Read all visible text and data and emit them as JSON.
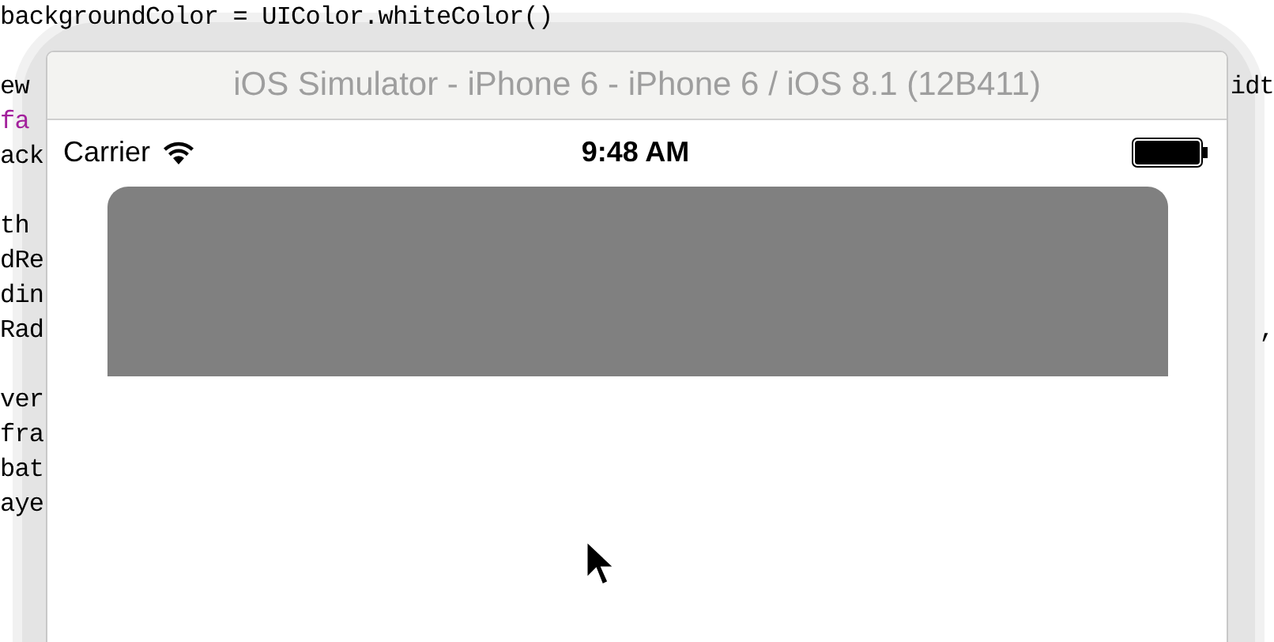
{
  "editor": {
    "blocks": [
      [
        {
          "kind": "plain",
          "text": "backgroundColor = UIColor.whiteColor()"
        }
      ],
      [
        {
          "kind": "plain",
          "text": "ew",
          "right": "idt"
        },
        {
          "kind": "keyword",
          "text": "fa"
        },
        {
          "kind": "plain",
          "text": "ack"
        }
      ],
      [
        {
          "kind": "plain",
          "text": "th"
        },
        {
          "kind": "plain",
          "text": "dRe"
        },
        {
          "kind": "plain",
          "text": "din"
        },
        {
          "kind": "plain",
          "text": "Rad",
          "right": ","
        }
      ],
      [
        {
          "kind": "plain",
          "text": "ver"
        },
        {
          "kind": "plain",
          "text": "fra"
        },
        {
          "kind": "plain",
          "text": "bat"
        },
        {
          "kind": "plain",
          "text": "aye"
        }
      ]
    ]
  },
  "simulator": {
    "title": "iOS Simulator - iPhone 6 - iPhone 6 / iOS 8.1 (12B411)",
    "status_bar": {
      "carrier": "Carrier",
      "time": "9:48 AM"
    }
  }
}
